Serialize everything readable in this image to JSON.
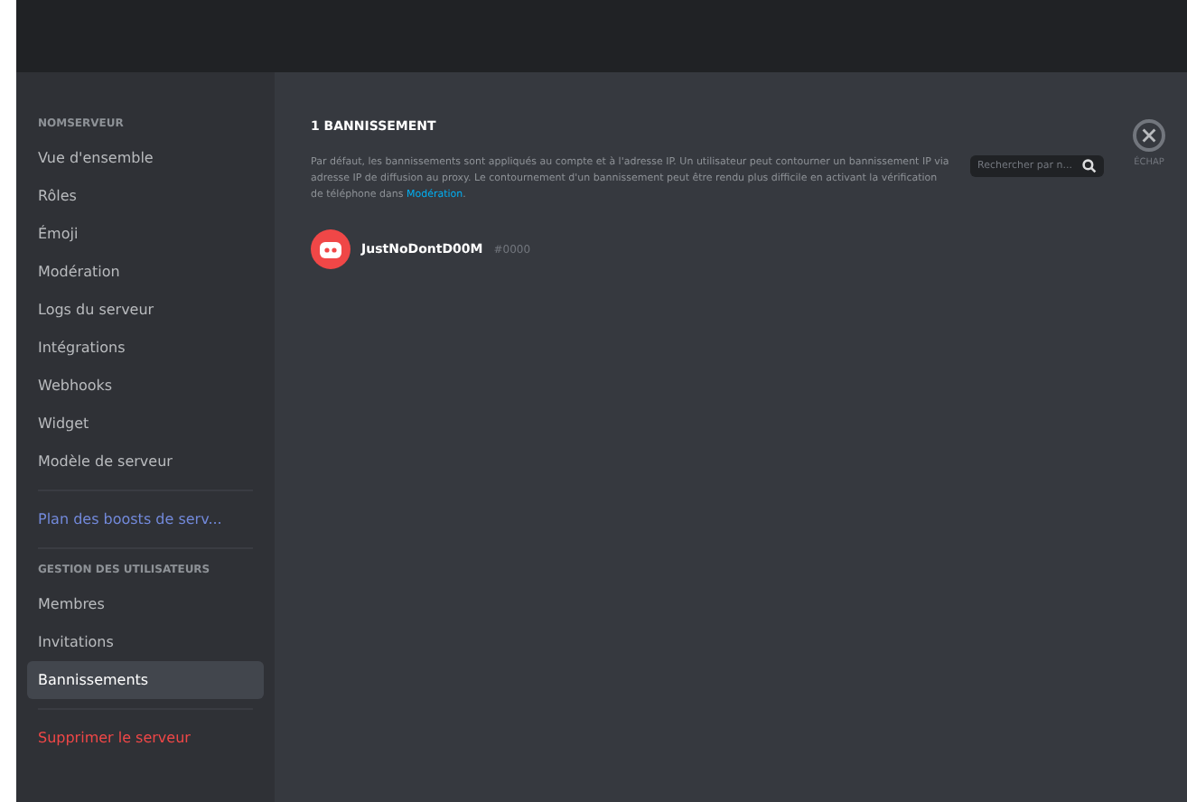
{
  "sidebar": {
    "header": "NOMSERVEUR",
    "items": [
      {
        "label": "Vue d'ensemble",
        "kind": "normal",
        "selected": false
      },
      {
        "label": "Rôles",
        "kind": "normal",
        "selected": false
      },
      {
        "label": "Émoji",
        "kind": "normal",
        "selected": false
      },
      {
        "label": "Modération",
        "kind": "normal",
        "selected": false
      },
      {
        "label": "Logs du serveur",
        "kind": "normal",
        "selected": false
      },
      {
        "label": "Intégrations",
        "kind": "normal",
        "selected": false
      },
      {
        "label": "Webhooks",
        "kind": "normal",
        "selected": false
      },
      {
        "label": "Widget",
        "kind": "normal",
        "selected": false
      },
      {
        "label": "Modèle de serveur",
        "kind": "normal",
        "selected": false
      },
      {
        "label": "Plan des boosts de serv...",
        "kind": "boost",
        "selected": false
      },
      {
        "label": "GESTION DES UTILISATEURS",
        "kind": "header"
      },
      {
        "label": "Membres",
        "kind": "normal",
        "selected": false
      },
      {
        "label": "Invitations",
        "kind": "normal",
        "selected": false
      },
      {
        "label": "Bannissements",
        "kind": "normal",
        "selected": true
      },
      {
        "label": "Supprimer le serveur",
        "kind": "danger",
        "selected": false
      }
    ]
  },
  "main": {
    "title": "1 BANNISSEMENT",
    "description": "Par défaut, les bannissements sont appliqués au compte et à l'adresse IP. Un utilisateur peut contourner un bannissement IP via adresse IP de diffusion au proxy. Le contournement d'un bannissement peut être rendu plus difficile en activant la vérification de téléphone dans ",
    "description_link": "Modération",
    "description_end": ".",
    "search": {
      "placeholder": "Rechercher par n..."
    },
    "close_label": "ÉCHAP",
    "bans": [
      {
        "name": "JustNoDontD00M",
        "tag": "#0000"
      }
    ]
  }
}
